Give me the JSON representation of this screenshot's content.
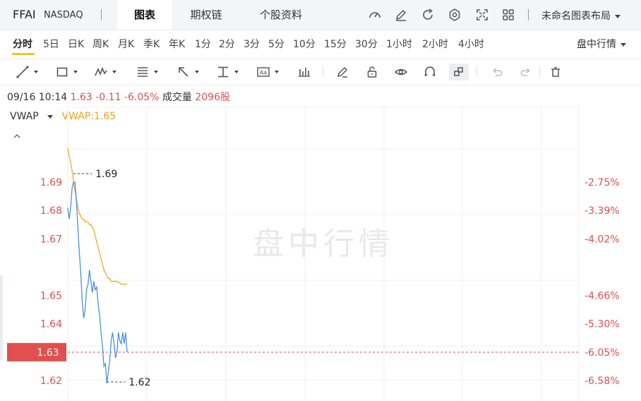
{
  "header": {
    "symbol": "FFAI",
    "exchange": "NASDAQ",
    "tabs": [
      {
        "label": "图表",
        "active": true
      },
      {
        "label": "期权链",
        "active": false
      },
      {
        "label": "个股资料",
        "active": false
      }
    ],
    "icons": [
      "gauge-icon",
      "pen-icon",
      "refresh-icon",
      "gear-icon",
      "fullscreen-icon",
      "grid-icon"
    ],
    "layout_label": "未命名图表布局"
  },
  "periods": {
    "items": [
      "分时",
      "5日",
      "日K",
      "周K",
      "月K",
      "季K",
      "年K",
      "1分",
      "2分",
      "3分",
      "5分",
      "10分",
      "15分",
      "30分",
      "1小时",
      "2小时",
      "4小时"
    ],
    "active": "分时",
    "session_label": "盘中行情"
  },
  "info": {
    "datetime": "09/16 10:14",
    "price": "1.63",
    "change": "-0.11",
    "change_pct": "-6.05%",
    "volume_label": "成交量",
    "volume": "2096股"
  },
  "indicator": {
    "name": "VWAP",
    "value_text": "VWAP:1.65"
  },
  "chart_data": {
    "type": "line",
    "watermark": "盘中行情",
    "y_ticks": [
      "1.69",
      "1.68",
      "1.67",
      "1.65",
      "1.64",
      "1.63",
      "1.62"
    ],
    "y_tick_values": [
      1.69,
      1.68,
      1.67,
      1.65,
      1.64,
      1.63,
      1.62
    ],
    "pct_ticks": [
      "-2.75%",
      "-3.39%",
      "-4.02%",
      "-4.66%",
      "-5.30%",
      "-6.05%",
      "-6.58%"
    ],
    "current_price": 1.63,
    "current_price_label": "1.63",
    "current_pct_label": "-6.05%",
    "high_label": "1.69",
    "low_label": "1.62",
    "ylim": [
      1.615,
      1.7
    ],
    "colors": {
      "price": "#4a90e2",
      "vwap": "#f0a024",
      "down": "#e14f4f"
    },
    "series": [
      {
        "name": "",
        "values": [
          1.681,
          1.677,
          1.681,
          1.688,
          1.69,
          1.69,
          1.683,
          1.674,
          1.665,
          1.658,
          1.648,
          1.642,
          1.645,
          1.652,
          1.654,
          1.659,
          1.655,
          1.651,
          1.655,
          1.652,
          1.653,
          1.647,
          1.643,
          1.637,
          1.632,
          1.625,
          1.626,
          1.619,
          1.623,
          1.627,
          1.634,
          1.637,
          1.633,
          1.628,
          1.63,
          1.637,
          1.634,
          1.633,
          1.637,
          1.633,
          1.637,
          1.63
        ]
      },
      {
        "name": "VWAP",
        "values": [
          1.702,
          1.699,
          1.697,
          1.694,
          1.69,
          1.687,
          1.684,
          1.681,
          1.679,
          1.678,
          1.677,
          1.677,
          1.676,
          1.676,
          1.676,
          1.675,
          1.675,
          1.674,
          1.673,
          1.671,
          1.669,
          1.667,
          1.665,
          1.663,
          1.661,
          1.659,
          1.658,
          1.657,
          1.656,
          1.656,
          1.655,
          1.655,
          1.655,
          1.655,
          1.655,
          1.6545,
          1.6545,
          1.654,
          1.654,
          1.654,
          1.654,
          1.654
        ]
      }
    ]
  }
}
